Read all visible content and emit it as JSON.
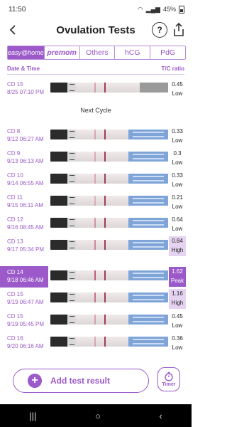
{
  "status": {
    "time": "11:50",
    "battery": "45%"
  },
  "header": {
    "title": "Ovulation Tests",
    "help": "?"
  },
  "tabs": [
    {
      "label": "easy@home"
    },
    {
      "label": "premom"
    },
    {
      "label": "Others"
    },
    {
      "label": "hCG"
    },
    {
      "label": "PdG"
    }
  ],
  "columns": {
    "date": "Date & Time",
    "ratio": "T/C ratio"
  },
  "next_cycle": "Next Cycle",
  "rows": [
    {
      "cd": "CD 15",
      "date": "8/25  07:10 PM",
      "value": "0.45",
      "level": "Low"
    },
    {
      "cd": "CD 8",
      "date": "9/12  06:27 AM",
      "value": "0.33",
      "level": "Low"
    },
    {
      "cd": "CD 9",
      "date": "9/13  06:13 AM",
      "value": "0.3",
      "level": "Low"
    },
    {
      "cd": "CD 10",
      "date": "9/14  06:55 AM",
      "value": "0.33",
      "level": "Low"
    },
    {
      "cd": "CD 11",
      "date": "9/15  06:11 AM",
      "value": "0.21",
      "level": "Low"
    },
    {
      "cd": "CD 12",
      "date": "9/16  08:45 AM",
      "value": "0.64",
      "level": "Low"
    },
    {
      "cd": "CD 13",
      "date": "9/17  05:34 PM",
      "value": "0.84",
      "level": "High"
    },
    {
      "cd": "CD 14",
      "date": "9/18  06:46 AM",
      "value": "1.62",
      "level": "Peak"
    },
    {
      "cd": "CD 15",
      "date": "9/19  06:47 AM",
      "value": "1.16",
      "level": "High"
    },
    {
      "cd": "CD 15",
      "date": "9/19  05:45 PM",
      "value": "0.45",
      "level": "Low"
    },
    {
      "cd": "CD 16",
      "date": "9/20  06:16 AM",
      "value": "0.36",
      "level": "Low"
    }
  ],
  "actions": {
    "add_label": "Add test result",
    "timer_label": "Timer"
  },
  "colors": {
    "accent": "#9b59c9",
    "high_bg": "#e6d3f2"
  }
}
